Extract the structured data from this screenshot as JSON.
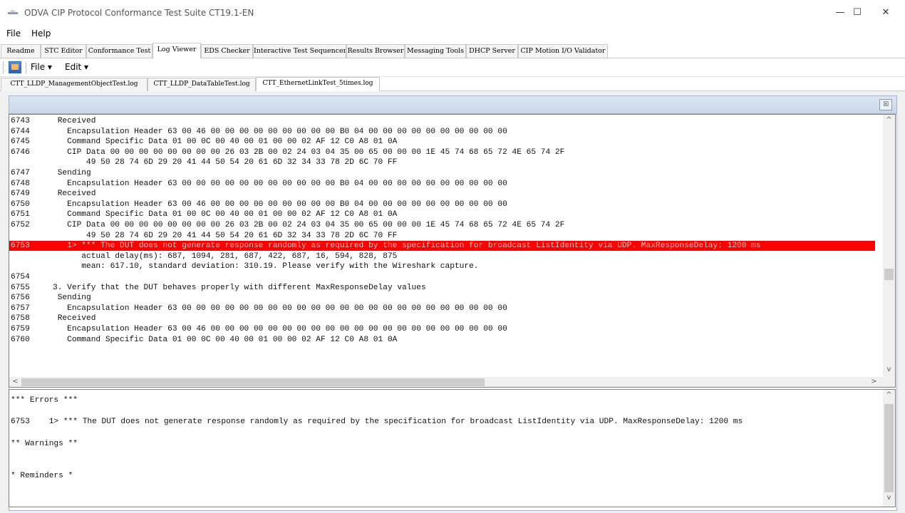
{
  "window": {
    "title": "ODVA CIP Protocol Conformance Test Suite CT19.1-EN",
    "minimize": "—",
    "maximize": "☐",
    "close": "✕"
  },
  "menu": {
    "file": "File",
    "help": "Help"
  },
  "main_tabs": [
    {
      "label": "Readme"
    },
    {
      "label": "STC Editor"
    },
    {
      "label": "Conformance Test"
    },
    {
      "label": "Log Viewer",
      "active": true
    },
    {
      "label": "EDS Checker"
    },
    {
      "label": "Interactive Test Sequencer"
    },
    {
      "label": "Results Browser"
    },
    {
      "label": "Messaging Tools"
    },
    {
      "label": "DHCP Server"
    },
    {
      "label": "CIP Motion I/O Validator"
    }
  ],
  "toolbar": {
    "file": "File ▾",
    "edit": "Edit ▾"
  },
  "file_tabs": [
    {
      "label": "CTT_LLDP_ManagementObjectTest.log"
    },
    {
      "label": "CTT_LLDP_DataTableTest.log"
    },
    {
      "label": "CTT_EthernetLinkTest_5times.log",
      "active": true
    }
  ],
  "panel": {
    "close": "☒"
  },
  "log_lines": [
    {
      "ln": "6743",
      "text": " Received"
    },
    {
      "ln": "6744",
      "text": "   Encapsulation Header 63 00 46 00 00 00 00 00 00 00 00 00 B0 04 00 00 00 00 00 00 00 00 00 00"
    },
    {
      "ln": "6745",
      "text": "   Command Specific Data 01 00 0C 00 40 00 01 00 00 02 AF 12 C0 A8 01 0A"
    },
    {
      "ln": "6746",
      "text": "   CIP Data 00 00 00 00 00 00 00 00 26 03 2B 00 02 24 03 04 35 00 65 00 00 00 1E 45 74 68 65 72 4E 65 74 2F"
    },
    {
      "ln": "",
      "text": "       49 50 28 74 6D 29 20 41 44 50 54 20 61 6D 32 34 33 78 2D 6C 70 FF"
    },
    {
      "ln": "6747",
      "text": " Sending"
    },
    {
      "ln": "6748",
      "text": "   Encapsulation Header 63 00 00 00 00 00 00 00 00 00 00 00 B0 04 00 00 00 00 00 00 00 00 00 00"
    },
    {
      "ln": "6749",
      "text": " Received"
    },
    {
      "ln": "6750",
      "text": "   Encapsulation Header 63 00 46 00 00 00 00 00 00 00 00 00 B0 04 00 00 00 00 00 00 00 00 00 00"
    },
    {
      "ln": "6751",
      "text": "   Command Specific Data 01 00 0C 00 40 00 01 00 00 02 AF 12 C0 A8 01 0A"
    },
    {
      "ln": "6752",
      "text": "   CIP Data 00 00 00 00 00 00 00 00 26 03 2B 00 02 24 03 04 35 00 65 00 00 00 1E 45 74 68 65 72 4E 65 74 2F"
    },
    {
      "ln": "",
      "text": "       49 50 28 74 6D 29 20 41 44 50 54 20 61 6D 32 34 33 78 2D 6C 70 FF"
    },
    {
      "ln": "6753",
      "text": "   1> *** The DUT does not generate response randomly as required by the specification for broadcast ListIdentity via UDP. MaxResponseDelay: 1200 ms",
      "error": true
    },
    {
      "ln": "",
      "text": "      actual delay(ms): 687, 1094, 281, 687, 422, 687, 16, 594, 828, 875"
    },
    {
      "ln": "",
      "text": "      mean: 617.10, standard deviation: 310.19. Please verify with the Wireshark capture."
    },
    {
      "ln": "6754",
      "text": ""
    },
    {
      "ln": "6755",
      "text": "3. Verify that the DUT behaves properly with different MaxResponseDelay values"
    },
    {
      "ln": "6756",
      "text": " Sending"
    },
    {
      "ln": "6757",
      "text": "   Encapsulation Header 63 00 00 00 00 00 00 00 00 00 00 00 00 00 00 00 00 00 00 00 00 00 00 00"
    },
    {
      "ln": "6758",
      "text": " Received"
    },
    {
      "ln": "6759",
      "text": "   Encapsulation Header 63 00 46 00 00 00 00 00 00 00 00 00 00 00 00 00 00 00 00 00 00 00 00 00"
    },
    {
      "ln": "6760",
      "text": "   Command Specific Data 01 00 0C 00 40 00 01 00 00 02 AF 12 C0 A8 01 0A"
    }
  ],
  "errors_panel": [
    "*** Errors ***",
    "",
    "6753    1> *** The DUT does not generate response randomly as required by the specification for broadcast ListIdentity via UDP. MaxResponseDelay: 1200 ms",
    "",
    "** Warnings **",
    "",
    "",
    "* Reminders *"
  ],
  "icons": {
    "up": "^",
    "down": "v",
    "left": "<",
    "right": ">"
  }
}
